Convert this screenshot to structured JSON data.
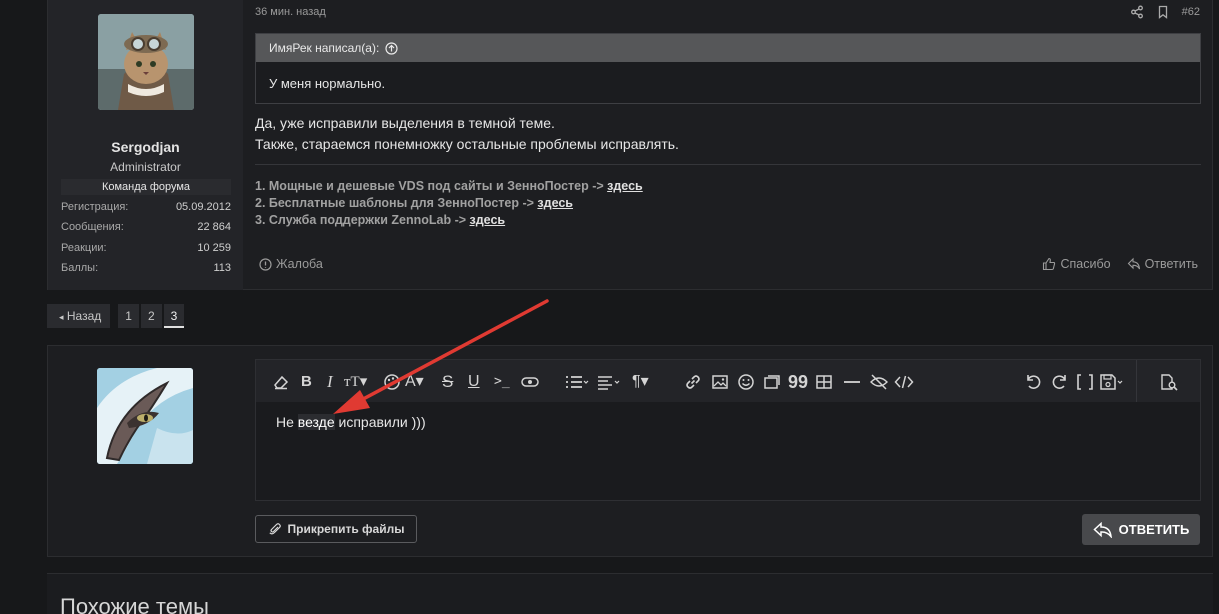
{
  "post": {
    "time": "36 мин. назад",
    "post_number": "#62",
    "user": {
      "name": "Sergodjan",
      "title": "Administrator",
      "banner": "Команда форума",
      "stats": [
        {
          "label": "Регистрация:",
          "value": "05.09.2012"
        },
        {
          "label": "Сообщения:",
          "value": "22 864"
        },
        {
          "label": "Реакции:",
          "value": "10 259"
        },
        {
          "label": "Баллы:",
          "value": "113"
        }
      ]
    },
    "quote": {
      "author": "ИмяРек написал(а):",
      "text": "У меня нормально."
    },
    "message": {
      "line1": "Да, уже исправили выделения в темной теме.",
      "line2": "Также, стараемся понемножку остальные проблемы исправлять."
    },
    "signature": [
      {
        "text": "1. Мощные и дешевые VDS под сайты и ЗенноПостер -> ",
        "link": "здесь"
      },
      {
        "text": "2. Бесплатные шаблоны для ЗенноПостер -> ",
        "link": "здесь"
      },
      {
        "text": "3. Служба поддержки ZennoLab -> ",
        "link": "здесь"
      }
    ],
    "actions": {
      "report": "Жалоба",
      "like": "Спасибо",
      "reply": "Ответить"
    }
  },
  "pagination": {
    "back": "Назад",
    "pages": [
      "1",
      "2",
      "3"
    ],
    "current": "3"
  },
  "reply_form": {
    "text_before": "Не ",
    "text_highlight": "везде",
    "text_after": " исправили )))",
    "attach_label": "Прикрепить файлы",
    "submit_label": "ОТВЕТИТЬ"
  },
  "similar": {
    "title": "Похожие темы"
  },
  "colors": {
    "arrow": "#e03a32",
    "background": "#17181a",
    "panel": "#1d1e21"
  }
}
